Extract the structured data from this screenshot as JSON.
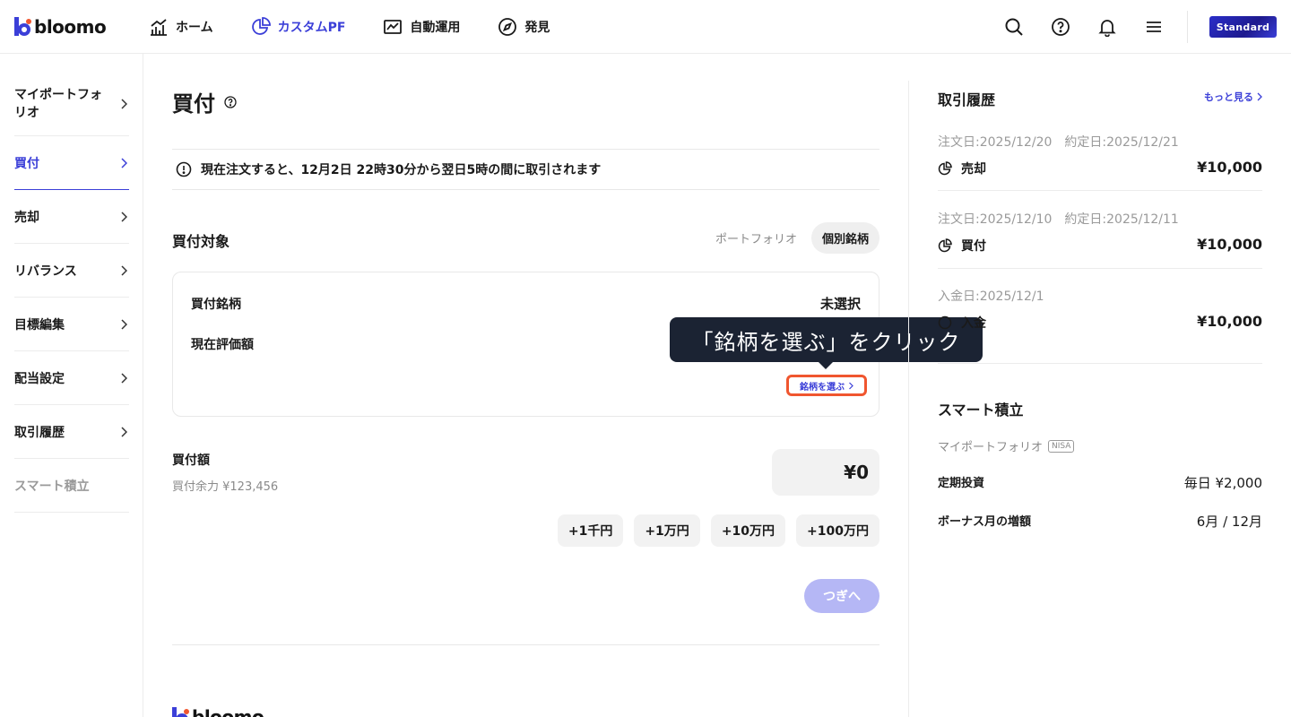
{
  "header": {
    "logo_text": "bloomo",
    "nav": [
      {
        "label": "ホーム",
        "icon": "chart-bar-icon",
        "active": false
      },
      {
        "label": "カスタムPF",
        "icon": "pie-chart-icon",
        "active": true
      },
      {
        "label": "自動運用",
        "icon": "line-chart-icon",
        "active": false
      },
      {
        "label": "発見",
        "icon": "compass-icon",
        "active": false
      }
    ],
    "icons": [
      "search-icon",
      "help-icon",
      "bell-icon",
      "menu-icon"
    ],
    "plan_badge": "Standard"
  },
  "sidebar": {
    "items": [
      {
        "label": "マイポートフォリオ",
        "state": "normal"
      },
      {
        "label": "買付",
        "state": "active"
      },
      {
        "label": "売却",
        "state": "normal"
      },
      {
        "label": "リバランス",
        "state": "normal"
      },
      {
        "label": "目標編集",
        "state": "normal"
      },
      {
        "label": "配当設定",
        "state": "normal"
      },
      {
        "label": "取引履歴",
        "state": "normal"
      },
      {
        "label": "スマート積立",
        "state": "disabled"
      }
    ]
  },
  "main": {
    "title": "買付",
    "notice": "現在注文すると、12月2日 22時30分から翌日5時の間に取引されます",
    "target_label": "買付対象",
    "toggle": {
      "options": [
        "ポートフォリオ",
        "個別銘柄"
      ],
      "selected": "個別銘柄"
    },
    "card": {
      "stock_label": "買付銘柄",
      "stock_value": "未選択",
      "valuation_label": "現在評価額",
      "select_button": "銘柄を選ぶ"
    },
    "tooltip": "「銘柄を選ぶ」をクリック",
    "amount_label": "買付額",
    "amount_sub": "買付余力 ¥123,456",
    "amount_value": "¥0",
    "chips": [
      "+1千円",
      "+1万円",
      "+10万円",
      "+100万円"
    ],
    "next_button": "つぎへ",
    "footer_logo_text": "bloomo"
  },
  "right": {
    "history_title": "取引履歴",
    "more_link": "もっと見る",
    "transactions": [
      {
        "date": "注文日:2025/12/20　約定日:2025/12/21",
        "type": "売却",
        "amount": "¥10,000"
      },
      {
        "date": "注文日:2025/12/10　約定日:2025/12/11",
        "type": "買付",
        "amount": "¥10,000"
      },
      {
        "date": "入金日:2025/12/1",
        "type": "入金",
        "amount": "¥10,000"
      }
    ],
    "smart_title": "スマート積立",
    "smart_sub": "マイポートフォリオ",
    "nisa_badge": "NISA",
    "rows": [
      {
        "label": "定期投資",
        "value": "毎日 ¥2,000"
      },
      {
        "label": "ボーナス月の増額",
        "value": "6月 / 12月"
      }
    ]
  },
  "colors": {
    "accent": "#3b3fd8",
    "tooltip_bg": "#1b2333",
    "highlight": "#f0562f",
    "disabled_button": "#b5b7f5"
  }
}
